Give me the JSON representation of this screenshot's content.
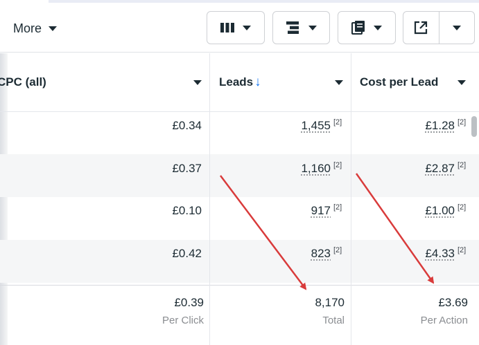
{
  "toolbar": {
    "more_label": "More",
    "buttons": [
      {
        "icon": "columns-icon"
      },
      {
        "icon": "breakdown-icon"
      },
      {
        "icon": "reports-icon"
      },
      {
        "icon": "export-icon"
      }
    ]
  },
  "columns": [
    {
      "label": "CPC (all)",
      "sort_indicator": ""
    },
    {
      "label": "Leads",
      "sort_indicator": "↓"
    },
    {
      "label": "Cost per Lead",
      "sort_indicator": ""
    }
  ],
  "rows": [
    {
      "cpc": "£0.34",
      "leads": "1,455",
      "leads_note": "[2]",
      "cost_per_lead": "£1.28",
      "cpl_note": "[2]"
    },
    {
      "cpc": "£0.37",
      "leads": "1,160",
      "leads_note": "[2]",
      "cost_per_lead": "£2.87",
      "cpl_note": "[2]"
    },
    {
      "cpc": "£0.10",
      "leads": "917",
      "leads_note": "[2]",
      "cost_per_lead": "£1.00",
      "cpl_note": "[2]"
    },
    {
      "cpc": "£0.42",
      "leads": "823",
      "leads_note": "[2]",
      "cost_per_lead": "£4.33",
      "cpl_note": "[2]"
    }
  ],
  "totals": {
    "cpc": "£0.39",
    "cpc_sub": "Per Click",
    "leads": "8,170",
    "leads_sub": "Total",
    "cost_per_lead": "£3.69",
    "cost_per_lead_sub": "Per Action"
  },
  "colors": {
    "annotation_arrow": "#d93b3b",
    "sort_arrow": "#1877f2",
    "row_alt": "#f5f6f7"
  }
}
